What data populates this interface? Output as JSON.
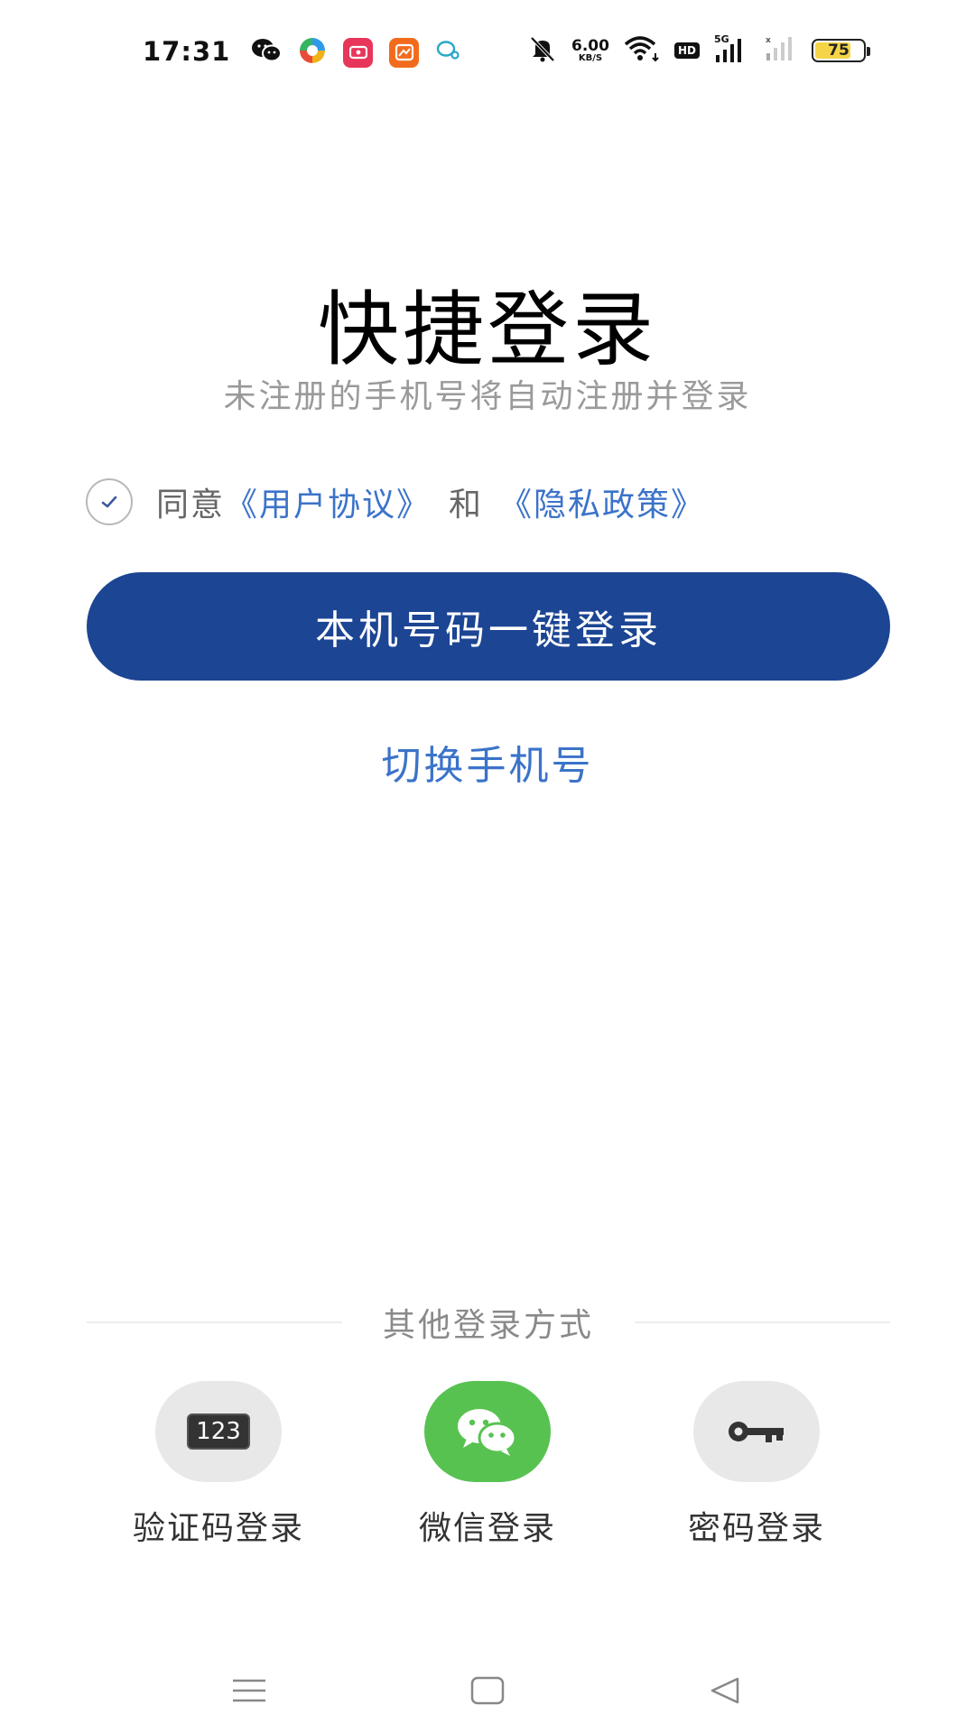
{
  "status_bar": {
    "time": "17:31",
    "net_speed_value": "6.00",
    "net_speed_unit": "KB/S",
    "hd_label": "HD",
    "network_label": "5G",
    "battery_level": "75",
    "battery_fraction": 0.75,
    "left_icons": [
      "wechat-icon",
      "app-pinwheel-icon",
      "app-red-video-icon",
      "app-orange-icon",
      "app-bubble-icon"
    ],
    "right_icons": [
      "mute-icon",
      "net-speed",
      "wifi-icon",
      "hd-icon",
      "signal-5g-icon",
      "signal-2-icon",
      "battery-icon"
    ]
  },
  "main": {
    "title": "快捷登录",
    "subtitle": "未注册的手机号将自动注册并登录",
    "agreement": {
      "prefix": "同意",
      "user_agreement": "《用户协议》",
      "and": "和",
      "privacy_policy": "《隐私政策》"
    },
    "one_click_button": "本机号码一键登录",
    "switch_phone": "切换手机号"
  },
  "other_login": {
    "divider_text": "其他登录方式",
    "options": [
      {
        "label": "验证码登录",
        "icon": "code-123-icon",
        "icon_text": "123"
      },
      {
        "label": "微信登录",
        "icon": "wechat-icon"
      },
      {
        "label": "密码登录",
        "icon": "key-icon"
      }
    ]
  },
  "nav_bar": {
    "buttons": [
      "menu-icon",
      "home-icon",
      "back-icon"
    ]
  },
  "colors": {
    "primary": "#1c4593",
    "link": "#3b73c9",
    "wechat_green": "#58c251",
    "option_gray": "#e8e8e8"
  }
}
